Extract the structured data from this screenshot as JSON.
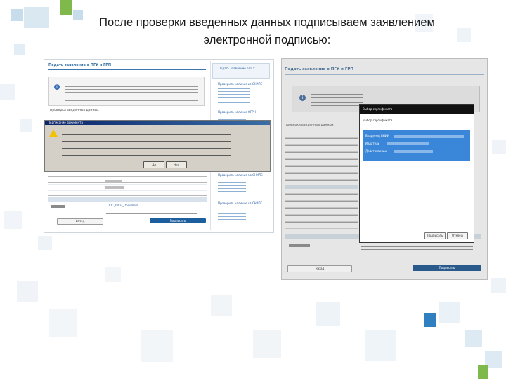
{
  "slide": {
    "title_line1": "После проверки введенных данных подписываем заявлением",
    "title_line2": "электронной подписью:"
  },
  "left_screenshot": {
    "page_title": "Подать заявление о ПГУ и ГРП",
    "sidebar_top_link": "Подать заявление о ПГУ",
    "sidebar_links": [
      "Проверить наличие из СНИЛС",
      "Проверить наличие ОГРН",
      "Проверить наличие по СНИЛС",
      "Проверить наличие из СНИЛС"
    ],
    "section_label": "Проверка введенных данных",
    "dialog_title": "Подписание документа",
    "dialog_button_yes": "Да",
    "dialog_button_no": "Нет",
    "file_name": "DOC_0002_Document",
    "back_button": "Назад",
    "submit_button": "Подписать"
  },
  "right_screenshot": {
    "page_title": "Подать заявление о ПГУ и ГРП",
    "section_label": "Проверка введенных данных",
    "dialog_title": "Выбор сертификата",
    "dialog_hint": "Выбор сертификата",
    "cert_line1": "Владелец ВНИИ",
    "cert_line2": "Издатель",
    "cert_line3": "Действителен",
    "ok_button": "Подписать",
    "cancel_button": "Отмена",
    "back_button": "Назад",
    "submit_button": "Подписать"
  }
}
